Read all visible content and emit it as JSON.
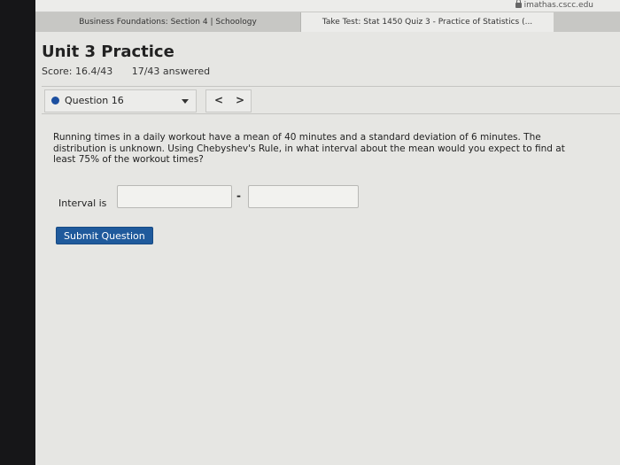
{
  "browser": {
    "url": "imathas.cscc.edu",
    "tabs": [
      {
        "label": "Business Foundations: Section 4 | Schoology"
      },
      {
        "label": "Take Test: Stat 1450 Quiz 3 - Practice of Statistics (..."
      }
    ]
  },
  "header": {
    "title": "Unit 3 Practice",
    "score": "Score: 16.4/43",
    "answered": "17/43 answered"
  },
  "question_nav": {
    "selected": "Question 16",
    "prev_symbol": "<",
    "next_symbol": ">"
  },
  "question": {
    "text": "Running times in a daily workout have a mean of 40 minutes and a standard deviation of 6 minutes. The distribution is unknown. Using Chebyshev's Rule, in what interval about the mean would you expect to find at least 75% of the workout times?",
    "interval_label": "Interval is",
    "separator": "-",
    "lower_value": "",
    "upper_value": ""
  },
  "actions": {
    "submit_label": "Submit Question"
  },
  "colors": {
    "accent": "#1f5a9c",
    "dot": "#1c4fa0"
  }
}
